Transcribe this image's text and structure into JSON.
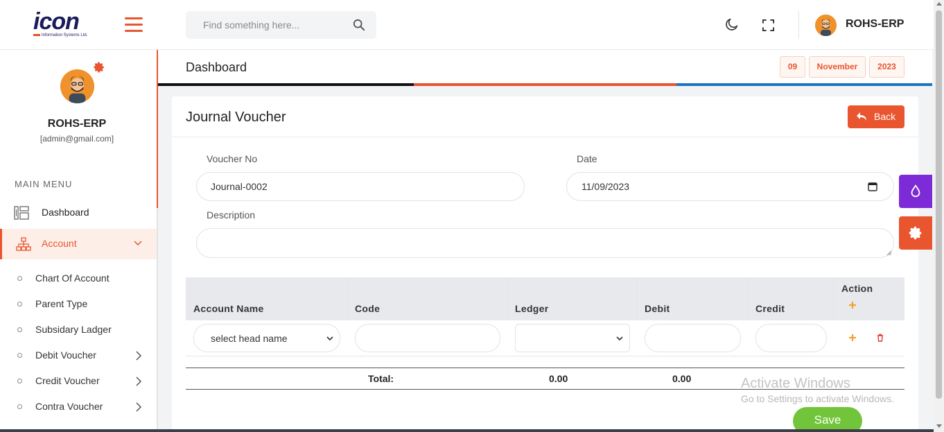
{
  "header": {
    "logo_text": "icon",
    "logo_sub": "Information Systems Ltd.",
    "search_placeholder": "Find something here...",
    "user_name": "ROHS-ERP"
  },
  "profile": {
    "name": "ROHS-ERP",
    "email": "[admin@gmail.com]"
  },
  "sidebar": {
    "menu_title": "MAIN MENU",
    "items": [
      {
        "label": "Dashboard",
        "icon": "dashboard-icon"
      },
      {
        "label": "Account",
        "icon": "sitemap-icon",
        "active": true
      }
    ],
    "sub_items": [
      {
        "label": "Chart Of Account"
      },
      {
        "label": "Parent Type"
      },
      {
        "label": "Subsidary Ladger"
      },
      {
        "label": "Debit Voucher",
        "has_children": true
      },
      {
        "label": "Credit Voucher",
        "has_children": true
      },
      {
        "label": "Contra Voucher",
        "has_children": true
      }
    ]
  },
  "page": {
    "title": "Dashboard",
    "date": {
      "day": "09",
      "month": "November",
      "year": "2023"
    }
  },
  "form": {
    "title": "Journal Voucher",
    "back_label": "Back",
    "voucher_no_label": "Voucher No",
    "voucher_no_value": "Journal-0002",
    "date_label": "Date",
    "date_value": "11/09/2023",
    "description_label": "Description",
    "description_value": ""
  },
  "table": {
    "headers": {
      "account_name": "Account Name",
      "code": "Code",
      "ledger": "Ledger",
      "debit": "Debit",
      "credit": "Credit",
      "action": "Action"
    },
    "rows": [
      {
        "account_name": "select head name",
        "code": "",
        "ledger": "",
        "debit": "",
        "credit": ""
      }
    ],
    "total_label": "Total:",
    "total_debit": "0.00",
    "total_credit": "0.00"
  },
  "watermark": {
    "line1": "Activate Windows",
    "line2": "Go to Settings to activate Windows."
  },
  "save_label": "Save",
  "colors": {
    "accent": "#e8552e",
    "purple": "#7c2bd6",
    "green": "#72c53a",
    "blue": "#1b75bc"
  }
}
